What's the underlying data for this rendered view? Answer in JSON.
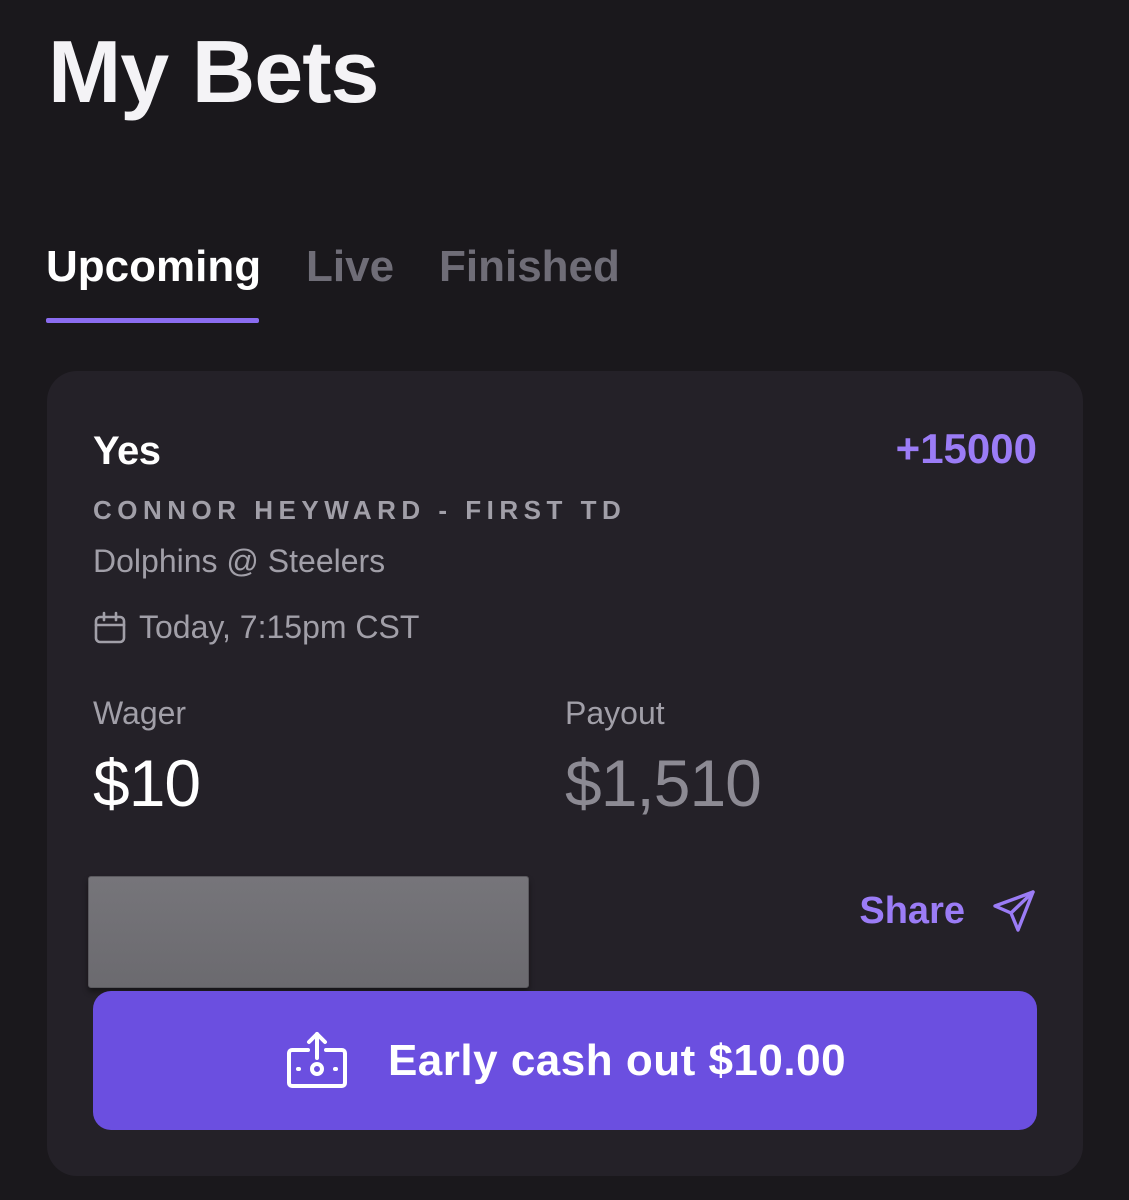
{
  "header": {
    "title": "My Bets"
  },
  "tabs": [
    {
      "label": "Upcoming",
      "active": true
    },
    {
      "label": "Live",
      "active": false
    },
    {
      "label": "Finished",
      "active": false
    }
  ],
  "bet": {
    "selection": "Yes",
    "odds": "+15000",
    "market": "CONNOR HEYWARD - FIRST TD",
    "matchup": "Dolphins @ Steelers",
    "datetime": "Today, 7:15pm CST",
    "datetime_icon": "calendar-icon",
    "wager_label": "Wager",
    "wager_value": "$10",
    "payout_label": "Payout",
    "payout_value": "$1,510",
    "share_label": "Share",
    "share_icon": "send-icon",
    "cashout_label": "Early cash out $10.00",
    "cashout_icon": "cash-out-icon"
  },
  "colors": {
    "background": "#1a181c",
    "card": "#242128",
    "accent": "#9b7cf6",
    "button": "#6b4fe0",
    "muted_text": "#a19fa8"
  }
}
